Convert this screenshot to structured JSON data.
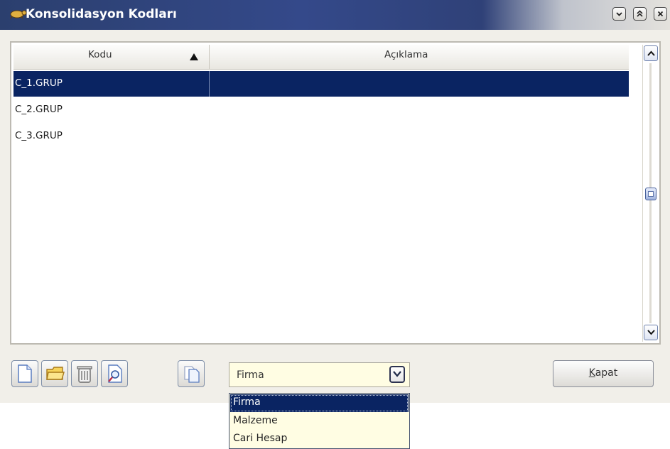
{
  "window": {
    "title": "Konsolidasyon Kodları",
    "title_icon": "tortoise-app-icon",
    "controls": [
      "minimize-icon",
      "maximize-icon",
      "close-icon"
    ]
  },
  "grid": {
    "columns": [
      {
        "label": "Kodu",
        "sort": "ascending"
      },
      {
        "label": "Açıklama"
      }
    ],
    "rows": [
      {
        "code": "C_1.GRUP",
        "description": "",
        "selected": true
      },
      {
        "code": "C_2.GRUP",
        "description": "",
        "selected": false
      },
      {
        "code": "C_3.GRUP",
        "description": "",
        "selected": false
      }
    ]
  },
  "toolbar": {
    "buttons": [
      "new-document-icon",
      "open-folder-icon",
      "trash-icon",
      "search-document-icon",
      "copy-document-icon"
    ],
    "combo_value": "Firma",
    "close_label": "Kapat"
  },
  "dropdown": {
    "options": [
      "Firma",
      "Malzeme",
      "Cari Hesap"
    ],
    "selected": "Firma"
  },
  "colors": {
    "title_bar": "#2f4178",
    "selection": "#0a2462",
    "combo_background": "#fffde3"
  }
}
